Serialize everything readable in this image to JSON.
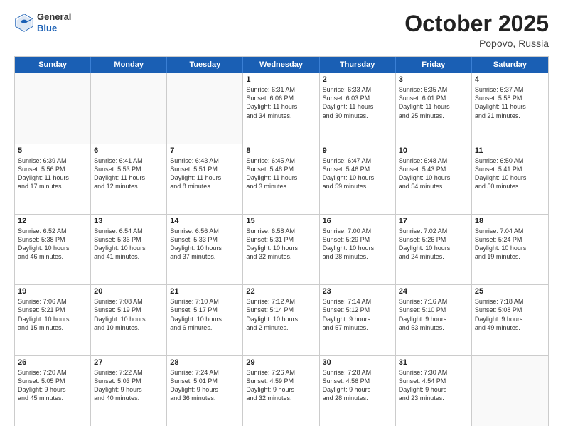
{
  "header": {
    "logo": {
      "line1": "General",
      "line2": "Blue"
    },
    "month": "October 2025",
    "location": "Popovo, Russia"
  },
  "weekdays": [
    "Sunday",
    "Monday",
    "Tuesday",
    "Wednesday",
    "Thursday",
    "Friday",
    "Saturday"
  ],
  "weeks": [
    [
      {
        "day": "",
        "text": ""
      },
      {
        "day": "",
        "text": ""
      },
      {
        "day": "",
        "text": ""
      },
      {
        "day": "1",
        "text": "Sunrise: 6:31 AM\nSunset: 6:06 PM\nDaylight: 11 hours\nand 34 minutes."
      },
      {
        "day": "2",
        "text": "Sunrise: 6:33 AM\nSunset: 6:03 PM\nDaylight: 11 hours\nand 30 minutes."
      },
      {
        "day": "3",
        "text": "Sunrise: 6:35 AM\nSunset: 6:01 PM\nDaylight: 11 hours\nand 25 minutes."
      },
      {
        "day": "4",
        "text": "Sunrise: 6:37 AM\nSunset: 5:58 PM\nDaylight: 11 hours\nand 21 minutes."
      }
    ],
    [
      {
        "day": "5",
        "text": "Sunrise: 6:39 AM\nSunset: 5:56 PM\nDaylight: 11 hours\nand 17 minutes."
      },
      {
        "day": "6",
        "text": "Sunrise: 6:41 AM\nSunset: 5:53 PM\nDaylight: 11 hours\nand 12 minutes."
      },
      {
        "day": "7",
        "text": "Sunrise: 6:43 AM\nSunset: 5:51 PM\nDaylight: 11 hours\nand 8 minutes."
      },
      {
        "day": "8",
        "text": "Sunrise: 6:45 AM\nSunset: 5:48 PM\nDaylight: 11 hours\nand 3 minutes."
      },
      {
        "day": "9",
        "text": "Sunrise: 6:47 AM\nSunset: 5:46 PM\nDaylight: 10 hours\nand 59 minutes."
      },
      {
        "day": "10",
        "text": "Sunrise: 6:48 AM\nSunset: 5:43 PM\nDaylight: 10 hours\nand 54 minutes."
      },
      {
        "day": "11",
        "text": "Sunrise: 6:50 AM\nSunset: 5:41 PM\nDaylight: 10 hours\nand 50 minutes."
      }
    ],
    [
      {
        "day": "12",
        "text": "Sunrise: 6:52 AM\nSunset: 5:38 PM\nDaylight: 10 hours\nand 46 minutes."
      },
      {
        "day": "13",
        "text": "Sunrise: 6:54 AM\nSunset: 5:36 PM\nDaylight: 10 hours\nand 41 minutes."
      },
      {
        "day": "14",
        "text": "Sunrise: 6:56 AM\nSunset: 5:33 PM\nDaylight: 10 hours\nand 37 minutes."
      },
      {
        "day": "15",
        "text": "Sunrise: 6:58 AM\nSunset: 5:31 PM\nDaylight: 10 hours\nand 32 minutes."
      },
      {
        "day": "16",
        "text": "Sunrise: 7:00 AM\nSunset: 5:29 PM\nDaylight: 10 hours\nand 28 minutes."
      },
      {
        "day": "17",
        "text": "Sunrise: 7:02 AM\nSunset: 5:26 PM\nDaylight: 10 hours\nand 24 minutes."
      },
      {
        "day": "18",
        "text": "Sunrise: 7:04 AM\nSunset: 5:24 PM\nDaylight: 10 hours\nand 19 minutes."
      }
    ],
    [
      {
        "day": "19",
        "text": "Sunrise: 7:06 AM\nSunset: 5:21 PM\nDaylight: 10 hours\nand 15 minutes."
      },
      {
        "day": "20",
        "text": "Sunrise: 7:08 AM\nSunset: 5:19 PM\nDaylight: 10 hours\nand 10 minutes."
      },
      {
        "day": "21",
        "text": "Sunrise: 7:10 AM\nSunset: 5:17 PM\nDaylight: 10 hours\nand 6 minutes."
      },
      {
        "day": "22",
        "text": "Sunrise: 7:12 AM\nSunset: 5:14 PM\nDaylight: 10 hours\nand 2 minutes."
      },
      {
        "day": "23",
        "text": "Sunrise: 7:14 AM\nSunset: 5:12 PM\nDaylight: 9 hours\nand 57 minutes."
      },
      {
        "day": "24",
        "text": "Sunrise: 7:16 AM\nSunset: 5:10 PM\nDaylight: 9 hours\nand 53 minutes."
      },
      {
        "day": "25",
        "text": "Sunrise: 7:18 AM\nSunset: 5:08 PM\nDaylight: 9 hours\nand 49 minutes."
      }
    ],
    [
      {
        "day": "26",
        "text": "Sunrise: 7:20 AM\nSunset: 5:05 PM\nDaylight: 9 hours\nand 45 minutes."
      },
      {
        "day": "27",
        "text": "Sunrise: 7:22 AM\nSunset: 5:03 PM\nDaylight: 9 hours\nand 40 minutes."
      },
      {
        "day": "28",
        "text": "Sunrise: 7:24 AM\nSunset: 5:01 PM\nDaylight: 9 hours\nand 36 minutes."
      },
      {
        "day": "29",
        "text": "Sunrise: 7:26 AM\nSunset: 4:59 PM\nDaylight: 9 hours\nand 32 minutes."
      },
      {
        "day": "30",
        "text": "Sunrise: 7:28 AM\nSunset: 4:56 PM\nDaylight: 9 hours\nand 28 minutes."
      },
      {
        "day": "31",
        "text": "Sunrise: 7:30 AM\nSunset: 4:54 PM\nDaylight: 9 hours\nand 23 minutes."
      },
      {
        "day": "",
        "text": ""
      }
    ]
  ]
}
